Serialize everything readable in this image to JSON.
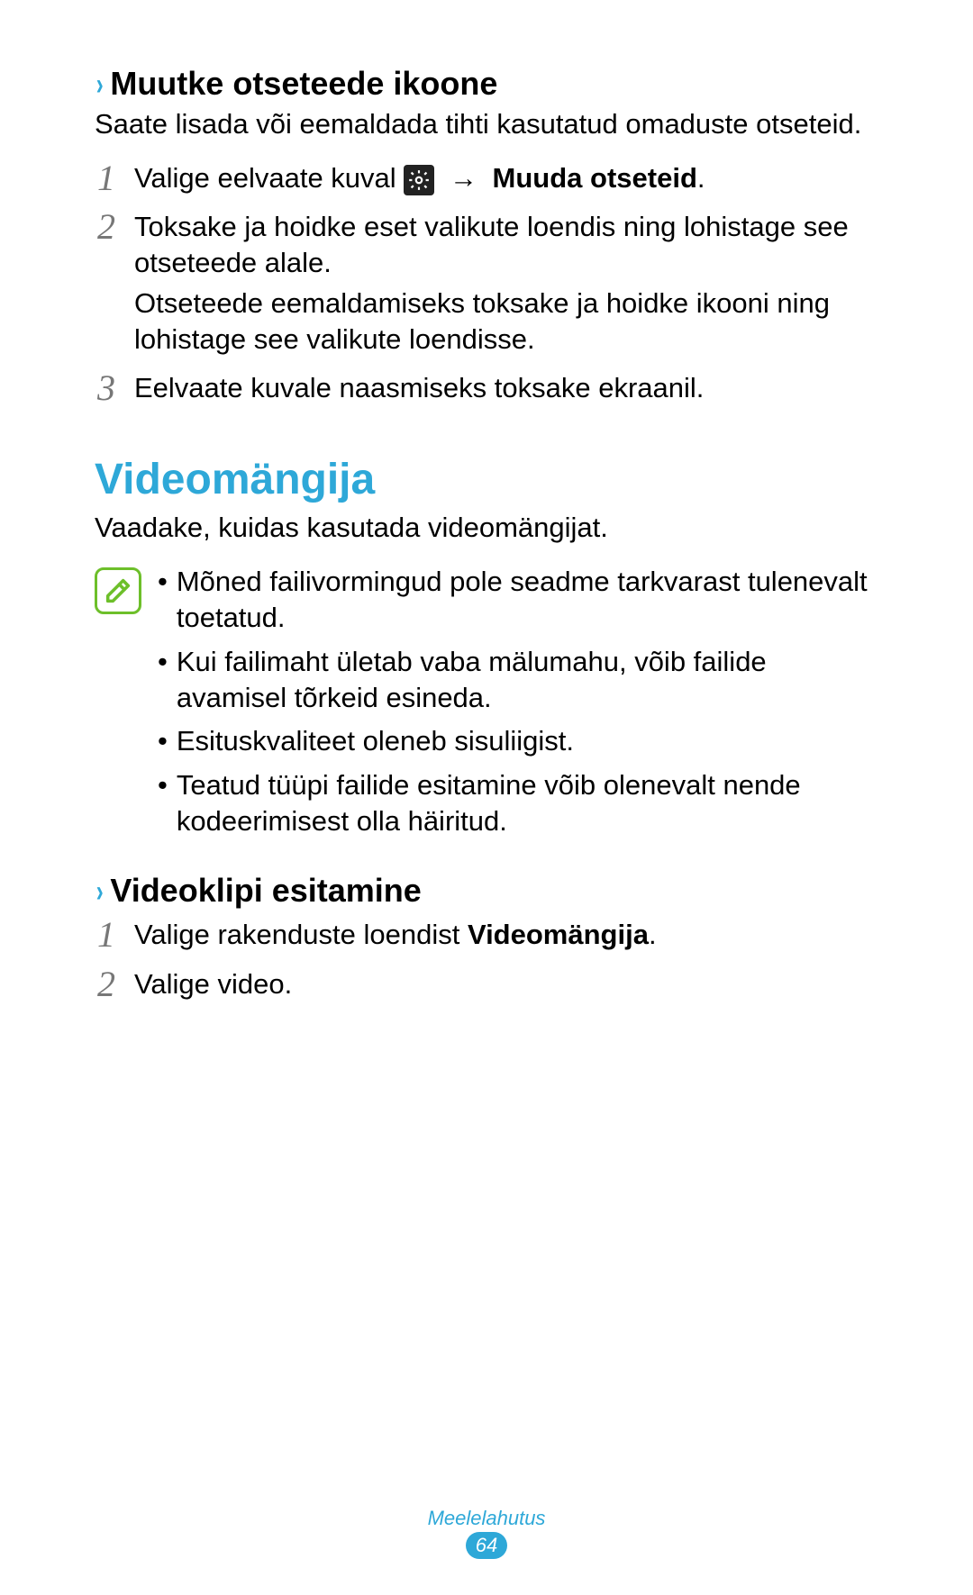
{
  "section1": {
    "heading": "Muutke otseteede ikoone",
    "intro": "Saate lisada või eemaldada tihti kasutatud omaduste otseteid.",
    "steps": [
      {
        "n": "1",
        "pre": "Valige eelvaate kuval ",
        "arrow": "→",
        "bold": "Muuda otseteid",
        "post": "."
      },
      {
        "n": "2",
        "line1": "Toksake ja hoidke eset valikute loendis ning lohistage see otseteede alale.",
        "line2": "Otseteede eemaldamiseks toksake ja hoidke ikooni ning lohistage see valikute loendisse."
      },
      {
        "n": "3",
        "line1": "Eelvaate kuvale naasmiseks toksake ekraanil."
      }
    ]
  },
  "section2": {
    "title": "Videomängija",
    "intro": "Vaadake, kuidas kasutada videomängijat.",
    "notes": [
      "Mõned failivormingud pole seadme tarkvarast tulenevalt toetatud.",
      "Kui failimaht ületab vaba mälumahu, võib failide avamisel tõrkeid esineda.",
      "Esituskvaliteet oleneb sisuliigist.",
      "Teatud tüüpi failide esitamine võib olenevalt nende kodeerimisest olla häiritud."
    ]
  },
  "section3": {
    "heading": "Videoklipi esitamine",
    "steps": [
      {
        "n": "1",
        "pre": "Valige rakenduste loendist ",
        "bold": "Videomängija",
        "post": "."
      },
      {
        "n": "2",
        "line1": "Valige video."
      }
    ]
  },
  "footer": {
    "label": "Meelelahutus",
    "page": "64"
  }
}
